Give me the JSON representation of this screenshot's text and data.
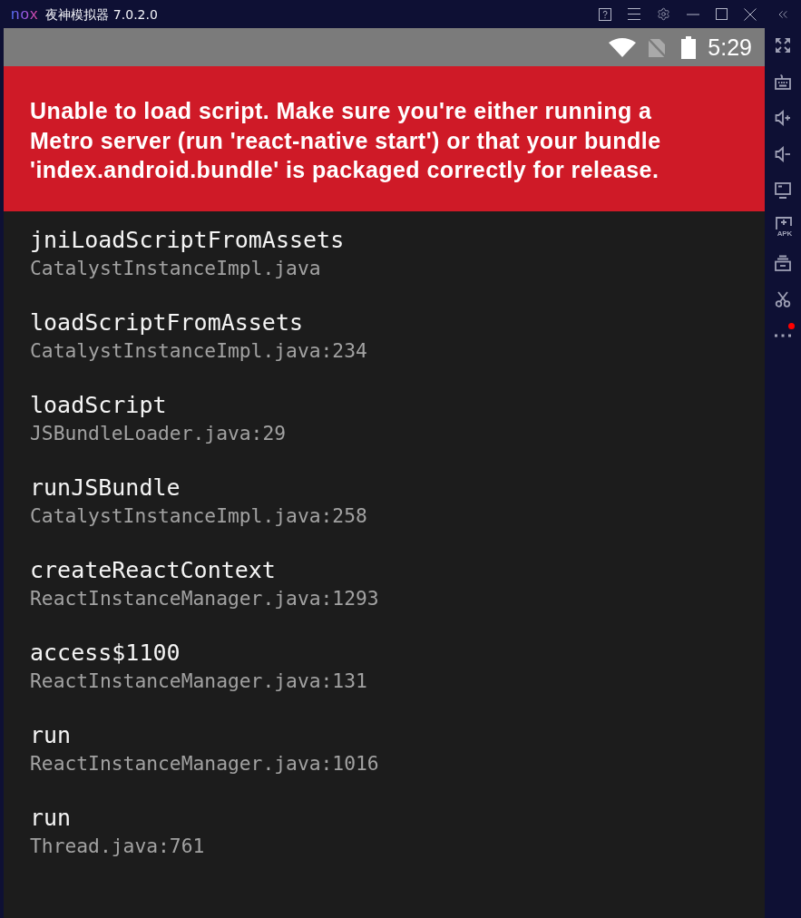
{
  "window": {
    "logo": "nox",
    "title": "夜神模拟器 7.0.2.0"
  },
  "status_bar": {
    "time": "5:29"
  },
  "error_banner": {
    "message": "Unable to load script. Make sure you're either running a Metro server (run 'react-native start') or that your bundle 'index.android.bundle' is packaged correctly for release."
  },
  "stack_frames": [
    {
      "method": "jniLoadScriptFromAssets",
      "file": "CatalystInstanceImpl.java"
    },
    {
      "method": "loadScriptFromAssets",
      "file": "CatalystInstanceImpl.java:234"
    },
    {
      "method": "loadScript",
      "file": "JSBundleLoader.java:29"
    },
    {
      "method": "runJSBundle",
      "file": "CatalystInstanceImpl.java:258"
    },
    {
      "method": "createReactContext",
      "file": "ReactInstanceManager.java:1293"
    },
    {
      "method": "access$1100",
      "file": "ReactInstanceManager.java:131"
    },
    {
      "method": "run",
      "file": "ReactInstanceManager.java:1016"
    },
    {
      "method": "run",
      "file": "Thread.java:761"
    }
  ],
  "sidebar": {
    "apk_label": "APK",
    "notification_dot": true
  }
}
